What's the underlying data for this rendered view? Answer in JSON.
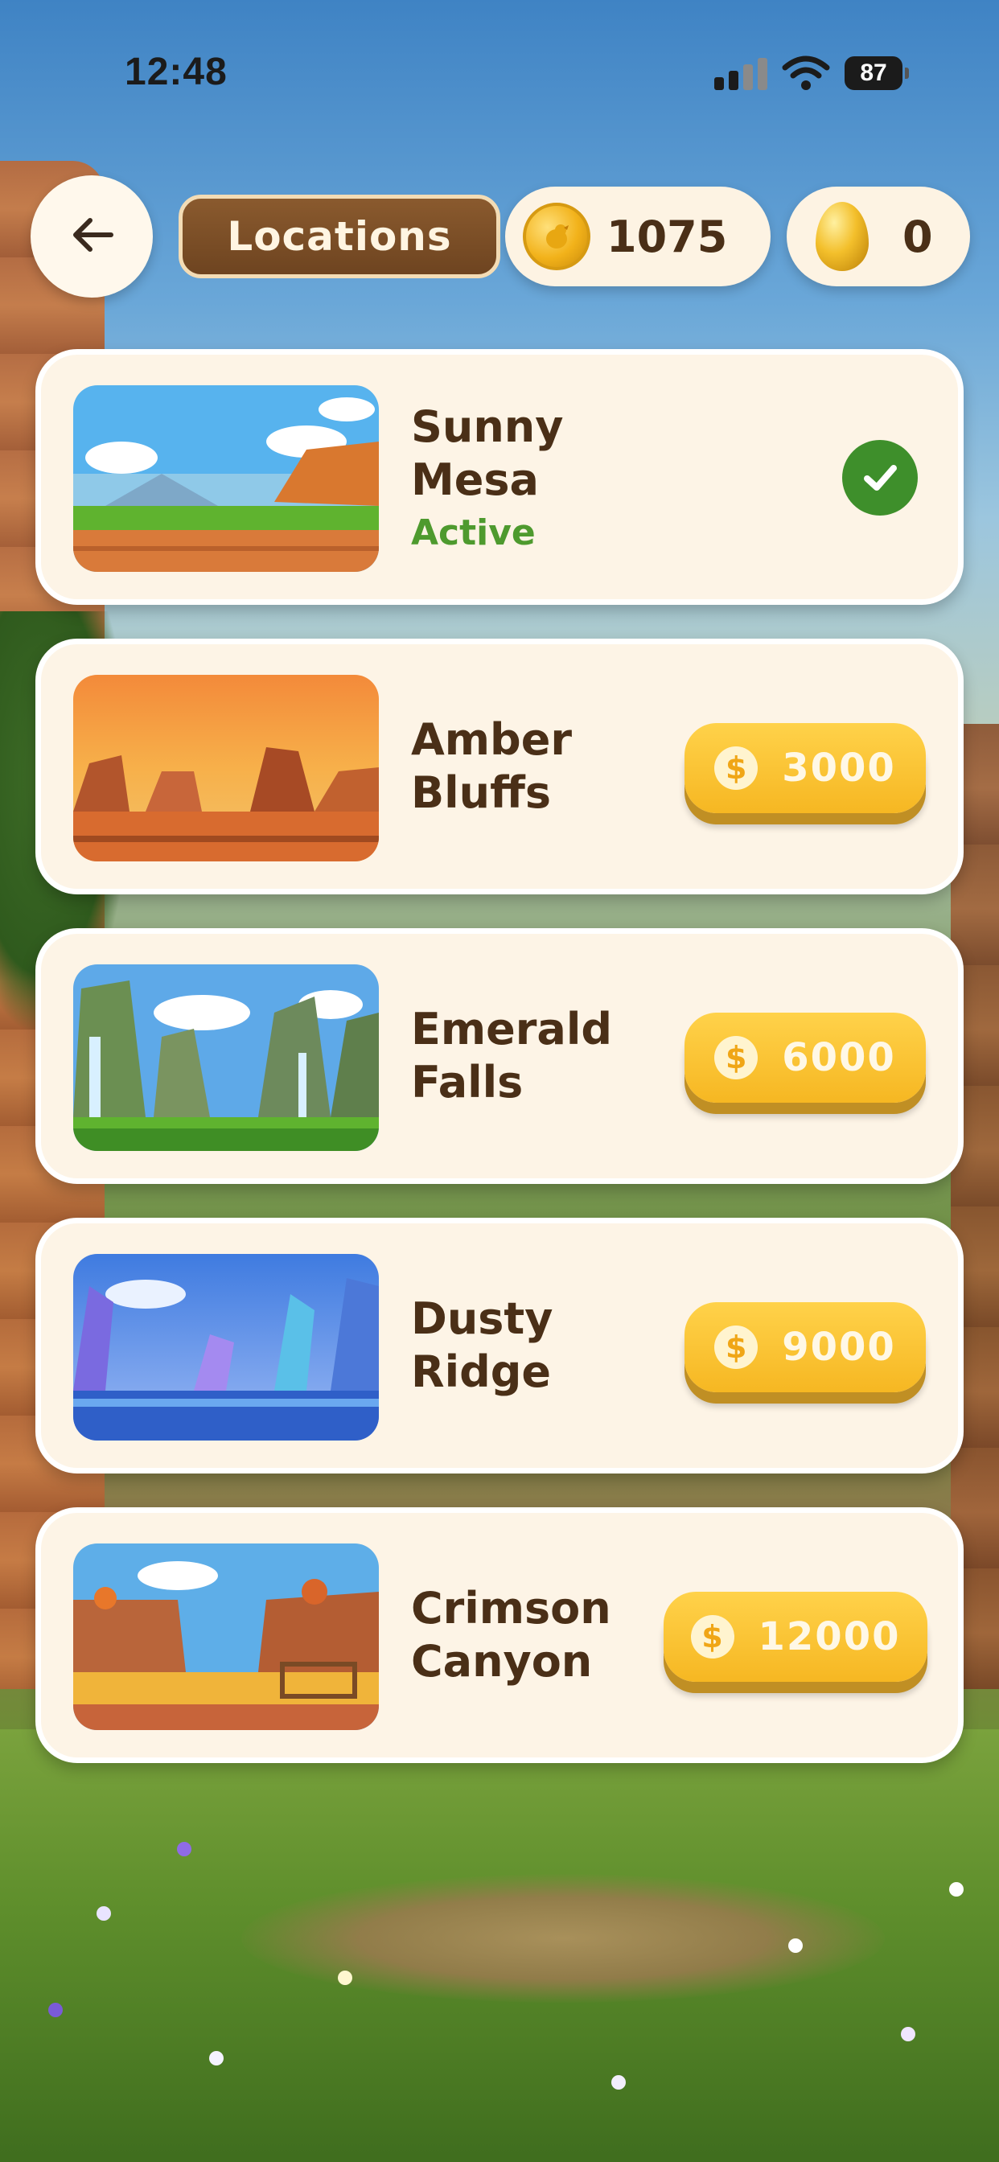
{
  "status_bar": {
    "time": "12:48",
    "battery": "87"
  },
  "header": {
    "title": "Locations",
    "coins": "1075",
    "eggs": "0"
  },
  "locations": [
    {
      "name_line1": "Sunny Mesa",
      "name_line2": "",
      "status": "Active",
      "price": null
    },
    {
      "name_line1": "Amber",
      "name_line2": "Bluffs",
      "status": "",
      "price": "3000"
    },
    {
      "name_line1": "Emerald",
      "name_line2": "Falls",
      "status": "",
      "price": "6000"
    },
    {
      "name_line1": "Dusty",
      "name_line2": "Ridge",
      "status": "",
      "price": "9000"
    },
    {
      "name_line1": "Crimson",
      "name_line2": "Canyon",
      "status": "",
      "price": "12000"
    }
  ],
  "icons": {
    "back": "arrow-left-icon",
    "coin": "coin-icon",
    "egg": "golden-egg-icon",
    "active": "check-icon",
    "price": "dollar-icon"
  },
  "colors": {
    "card_bg": "#fdf4e6",
    "title_text": "#4a2f17",
    "active_green": "#4e9a2e",
    "price_button": "#f6b722"
  }
}
